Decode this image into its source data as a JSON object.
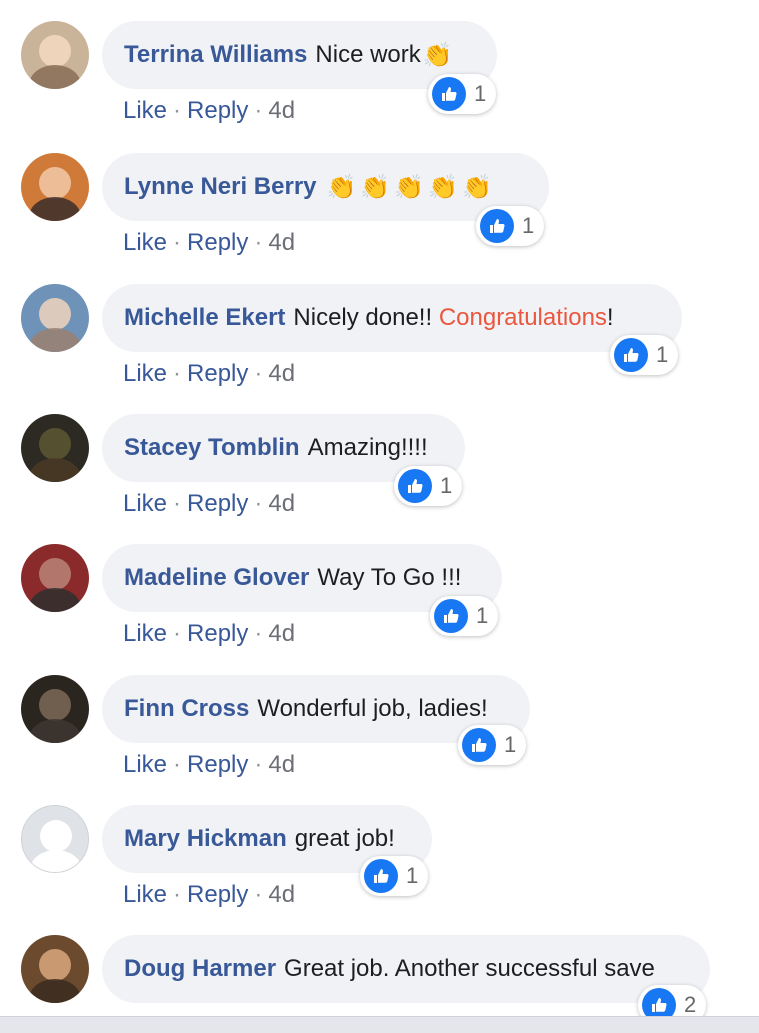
{
  "colors": {
    "link": "#385898",
    "text": "#1c1e21",
    "bubble": "#f0f2f5",
    "like_blue": "#1877f2",
    "highlight": "#e9573f"
  },
  "icons": {
    "reaction": "thumbs-up-icon",
    "emoji": "clapping-hands-icon"
  },
  "comments": [
    {
      "author": "Terrina Williams",
      "text": "Nice work",
      "emoji": "👏",
      "like": "Like",
      "reply": "Reply",
      "time": "4d",
      "reactions": "1"
    },
    {
      "author": "Lynne Neri Berry",
      "text": "",
      "emoji": "👏👏👏👏👏",
      "like": "Like",
      "reply": "Reply",
      "time": "4d",
      "reactions": "1"
    },
    {
      "author": "Michelle Ekert",
      "text_a": "Nicely done!! ",
      "text_hl": "Congratulations",
      "text_b": "!",
      "like": "Like",
      "reply": "Reply",
      "time": "4d",
      "reactions": "1"
    },
    {
      "author": "Stacey Tomblin",
      "text": "Amazing!!!!",
      "like": "Like",
      "reply": "Reply",
      "time": "4d",
      "reactions": "1"
    },
    {
      "author": "Madeline Glover",
      "text": "Way To Go !!!",
      "like": "Like",
      "reply": "Reply",
      "time": "4d",
      "reactions": "1"
    },
    {
      "author": "Finn Cross",
      "text": "Wonderful job, ladies!",
      "like": "Like",
      "reply": "Reply",
      "time": "4d",
      "reactions": "1"
    },
    {
      "author": "Mary Hickman",
      "text": "great job!",
      "like": "Like",
      "reply": "Reply",
      "time": "4d",
      "reactions": "1"
    },
    {
      "author": "Doug Harmer",
      "text": "Great job. Another successful save",
      "reactions": "2"
    }
  ]
}
